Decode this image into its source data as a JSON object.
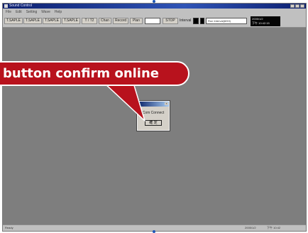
{
  "app": {
    "window_title": "Sound Control"
  },
  "menubar": {
    "items": [
      "File",
      "Edit",
      "Setting",
      "Wave",
      "Help"
    ]
  },
  "toolbar": {
    "buttons": [
      "T.SAPLE",
      "T.SAPLE",
      "T.SAPLE",
      "T.SAPLE",
      "T / T2",
      "Chan",
      "Record",
      "Plan"
    ],
    "stop_label": "STOP",
    "interval_label": "Interval",
    "run_interval": "Run Interval(8/53)",
    "date_line1": "2005/1/2",
    "date_line2": "下午 10:42:15"
  },
  "dialog": {
    "message": "Com Connect",
    "ok_label": "確 定"
  },
  "callout": {
    "text": "button confirm online"
  },
  "statusbar": {
    "left": "Ready",
    "date": "2005/1/2",
    "time": "下午 10:42"
  },
  "colors": {
    "workspace": "#7e7e7e",
    "callout_fill": "#b8121d",
    "titlebar": "#0c1f6f"
  }
}
